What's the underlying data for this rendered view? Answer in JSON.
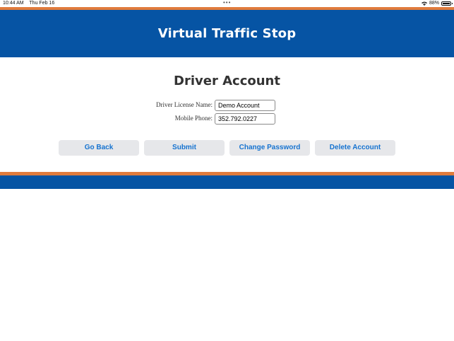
{
  "status_bar": {
    "time": "10:44 AM",
    "date": "Thu Feb 16",
    "battery": "88%"
  },
  "header": {
    "title": "Virtual Traffic Stop"
  },
  "page": {
    "title": "Driver Account"
  },
  "form": {
    "license_label": "Driver License Name:",
    "license_value": "Demo Account",
    "phone_label": "Mobile Phone:",
    "phone_value": "352.792.0227"
  },
  "buttons": {
    "go_back": "Go Back",
    "submit": "Submit",
    "change_password": "Change Password",
    "delete_account": "Delete Account"
  },
  "colors": {
    "brand_blue": "#0654a4",
    "accent_orange": "#e07b3c",
    "button_text": "#1673d0"
  }
}
